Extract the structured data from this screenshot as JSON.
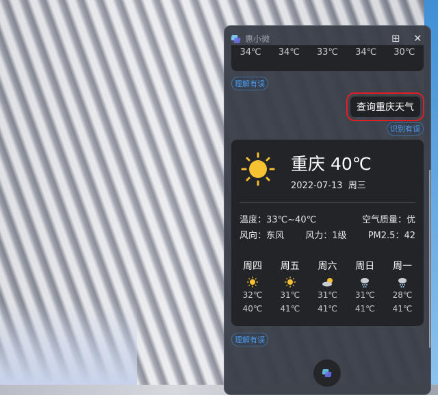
{
  "window": {
    "title": "惠小微",
    "grid_icon": "grid-icon",
    "close_icon": "close-icon"
  },
  "prev_card": {
    "temps": [
      "34℃",
      "34℃",
      "33℃",
      "34℃",
      "30℃"
    ]
  },
  "feedback": {
    "understand_error": "理解有误",
    "recognize_error": "识别有误"
  },
  "user_query": "查询重庆天气",
  "weather": {
    "city": "重庆",
    "temp": "40℃",
    "date": "2022-07-13",
    "weekday": "周三",
    "icon": "sun-icon",
    "temp_range_label": "温度：",
    "temp_range": "33℃~40℃",
    "air_label": "空气质量：",
    "air": "优",
    "wind_dir_label": "风向：",
    "wind_dir": "东风",
    "wind_force_label": "风力：",
    "wind_force": "1级",
    "pm_label": "PM2.5：",
    "pm": "42",
    "forecast": [
      {
        "day": "周四",
        "icon": "sun-icon",
        "low": "32℃",
        "high": "40℃"
      },
      {
        "day": "周五",
        "icon": "sun-icon",
        "low": "31℃",
        "high": "41℃"
      },
      {
        "day": "周六",
        "icon": "partly-cloudy-icon",
        "low": "31℃",
        "high": "41℃"
      },
      {
        "day": "周日",
        "icon": "rain-icon",
        "low": "31℃",
        "high": "41℃"
      },
      {
        "day": "周一",
        "icon": "rain-icon",
        "low": "28℃",
        "high": "41℃"
      }
    ]
  },
  "colors": {
    "accent": "#4c9ae8",
    "sun": "#f6c232",
    "highlight": "#e01e24"
  }
}
